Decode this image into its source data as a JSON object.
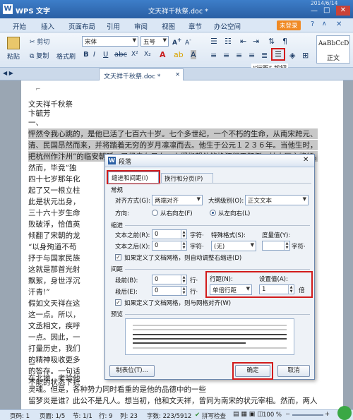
{
  "titlebar": {
    "app": "WPS 文字",
    "doc_title": "文天祥千秋祭.doc *",
    "date": "2014/6/14"
  },
  "menu": [
    "开始",
    "插入",
    "页面布局",
    "引用",
    "审阅",
    "视图",
    "章节",
    "办公空间"
  ],
  "menu_right": {
    "unlogged": "未登录"
  },
  "ribbon": {
    "cut": "剪切",
    "copy": "复制",
    "paste": "粘贴",
    "format_painter": "格式刷",
    "font": "宋体",
    "size": "五号",
    "style_sample": "AaBbCcD",
    "style_name": "正文",
    "annotation": "“行距” 按钮"
  },
  "doctabs": {
    "tab": "文天祥千秋祭.doc *"
  },
  "document": {
    "lines": [
      "文天祥千秋祭",
      "卞毓芳",
      "一、",
      "怦然令我心跳的，是他已活了七百六十岁。七个多世纪，一个不朽的生命，从南宋跨元、明、",
      "清、民国昂然而来，并将踏着无穷的岁月凛凛而去。他生于公元１２３６年。当他生时，“直",
      "把杭州作汴州”的临安朝廷，已经走在日夕。人们指望他能挽狂澜于既倒，扶大厦之将倾。",
      "然而，毕竟“独",
      "四十七岁那年化",
      "起了又一根立柱",
      "此是状元出身，",
      "三十六十岁生命",
      "败破浮，恰值英",
      "倾翻了宋朝的龙",
      "“以身殉道不苟",
      "抒于与国家民族",
      "这就是那首光射",
      "飘絮，身世浮沉",
      "汗青!”",
      "假如文天祥在这",
      "这一点。所以，",
      "文丞相文，疾呼",
      "一点。因此，一",
      "打量历史，我们",
      "的精神吸收更多",
      "的答存。一句话",
      "不能的状态下抵",
      "二、",
      "在北地，考验他",
      "灵魂。但是，各种势力同时看重的是他的品德中的一些",
      "留梦炎是谁？此公不是凡人。想当初，他和文天祥，曾同为南宋的状元宰相。然而，两人位"
    ]
  },
  "dialog": {
    "title": "段落",
    "tabs": [
      "缩进和间距(I)",
      "换行和分页(P)"
    ],
    "general_label": "常规",
    "alignment_label": "对齐方式(G):",
    "alignment_value": "两端对齐",
    "outline_label": "大纲级别(O):",
    "outline_value": "正文文本",
    "direction_label": "方向:",
    "rtl_label": "从右向左(F)",
    "ltr_label": "从左向右(L)",
    "indent_label": "缩进",
    "before_text_label": "文本之前(R):",
    "before_text_value": "0",
    "after_text_label": "文本之后(X):",
    "after_text_value": "0",
    "char_unit": "字符·",
    "special_label": "特殊格式(S):",
    "special_value": "(无)",
    "measure_label": "度量值(Y):",
    "indent_grid_label": "如果定义了文档网格，则自动调整右缩进(D)",
    "spacing_label": "间距",
    "before_label": "段前(B):",
    "before_value": "0",
    "after_label": "段后(E):",
    "after_value": "0",
    "line_unit": "行·",
    "line_spacing_label": "行距(N):",
    "line_spacing_value": "单倍行距",
    "set_value_label": "设置值(A):",
    "set_value": "1",
    "set_unit": "倍",
    "snap_grid_label": "如果定义了文档网格，则与网格对齐(W)",
    "preview_label": "预览",
    "tabs_button": "制表位(T)...",
    "ok": "确定",
    "cancel": "取消"
  },
  "status": {
    "page": "页码: 1",
    "pages": "页面: 1/5",
    "section": "节: 1/1",
    "row": "行: 9",
    "col": "列: 23",
    "words": "字数: 223/5912",
    "spell": "拼写检查",
    "zoom": "100 %"
  },
  "colors": {
    "accent_red": "#d21b1b",
    "titlebar": "#2f6bb3"
  }
}
